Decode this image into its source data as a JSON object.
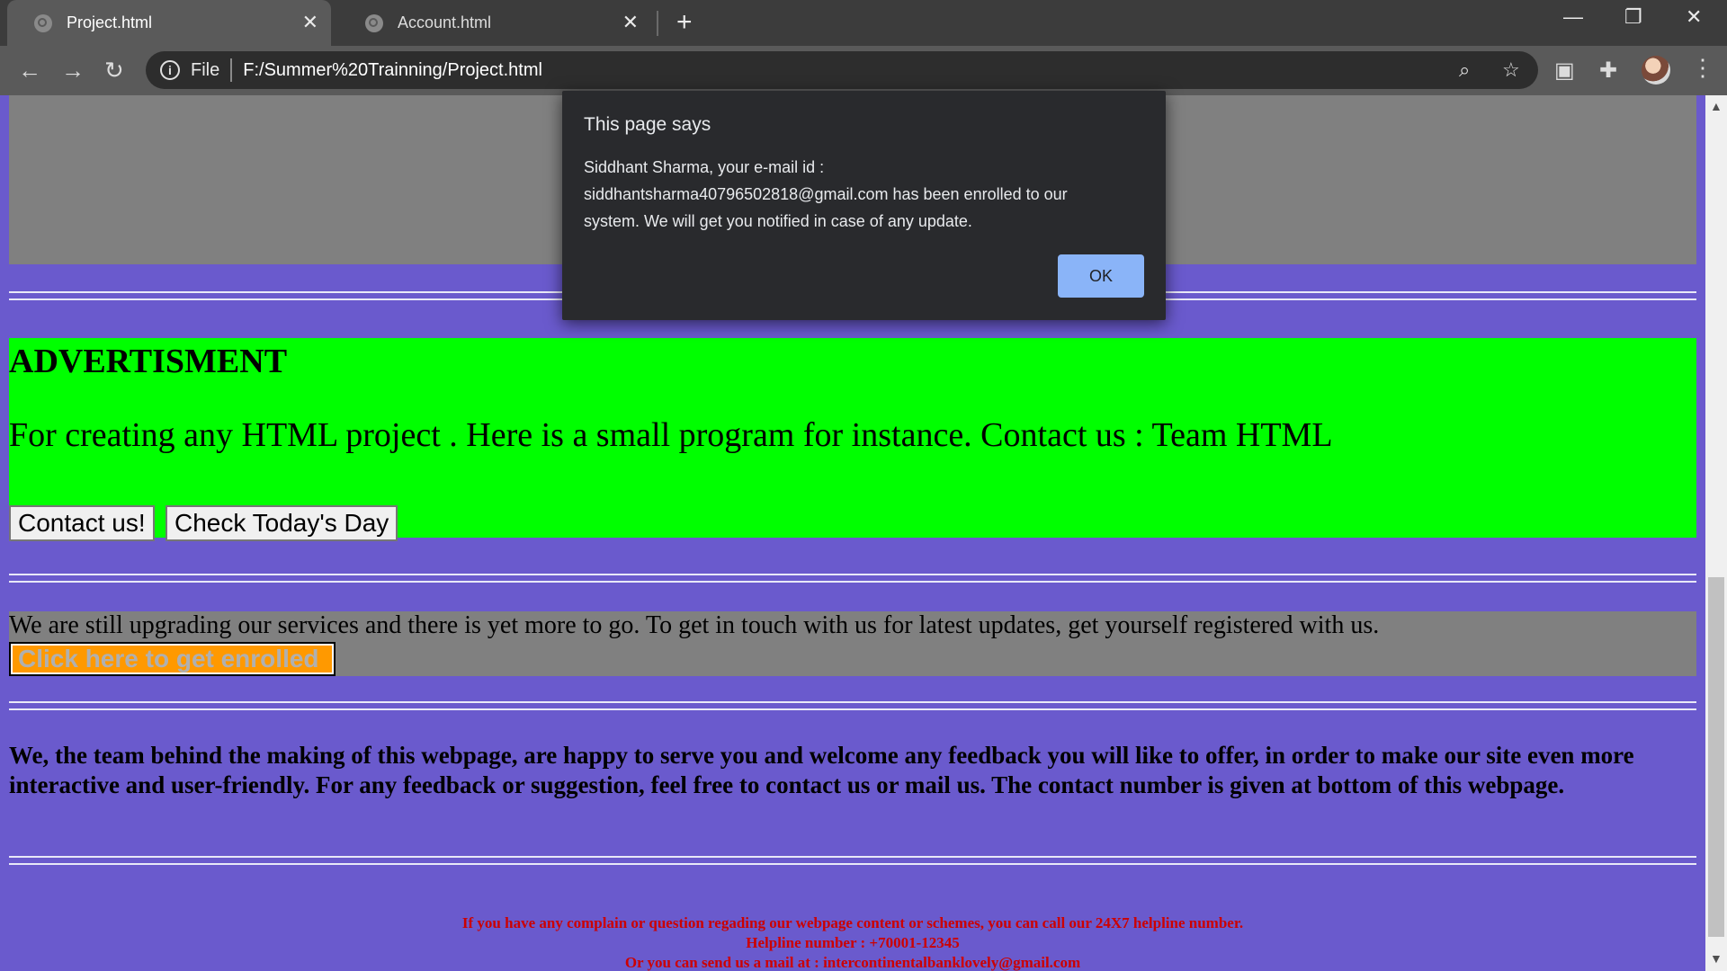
{
  "browser": {
    "tabs": [
      {
        "title": "Project.html",
        "active": true
      },
      {
        "title": "Account.html",
        "active": false
      }
    ],
    "address": {
      "scheme_label": "File",
      "url": "F:/Summer%20Trainning/Project.html"
    }
  },
  "page": {
    "ad": {
      "title": "ADVERTISMENT",
      "text": "For creating any HTML project . Here is a small program for instance. Contact us : Team HTML",
      "contact_button": "Contact us!",
      "day_button": "Check Today's Day"
    },
    "upgrade": {
      "text": "We are still upgrading our services and there is yet more to go. To get in touch with us for latest updates, get yourself registered with us.",
      "enroll_button": "Click here to get enrolled"
    },
    "team_text": "We, the team behind the making of this webpage, are happy to serve you and welcome any feedback you will like to offer, in order to make our site even more interactive and user-friendly. For any feedback or suggestion, feel free to contact us or mail us. The contact number is given at bottom of this webpage.",
    "footer": {
      "line1": "If you have any complain or question regading our webpage content or schemes, you can call our 24X7 helpline number.",
      "line2": "Helpline number : +70001-12345",
      "line3": "Or you can send us a mail at : intercontinentalbanklovely@gmail.com"
    }
  },
  "dialog": {
    "title": "This page says",
    "message": "Siddhant Sharma, your e-mail id : siddhantsharma40796502818@gmail.com has been enrolled to our system. We will get you notified in case of any update.",
    "ok_label": "OK"
  },
  "colors": {
    "page_bg": "#6a5acd",
    "ad_bg": "#00ff00",
    "enroll_bg": "#ff9900",
    "footer_text": "#cc0000",
    "dialog_bg": "#292a2d",
    "ok_bg": "#8ab4f8"
  }
}
